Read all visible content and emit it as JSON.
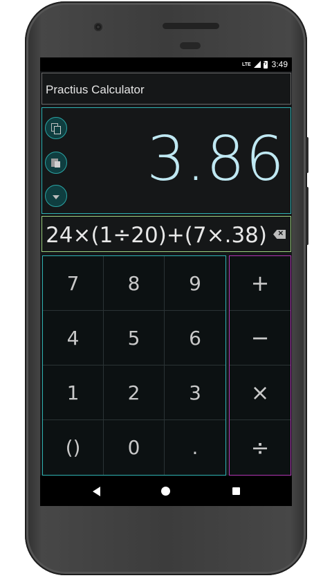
{
  "status_bar": {
    "network": "LTE",
    "time": "3:49"
  },
  "app": {
    "title": "Practius Calculator"
  },
  "result": {
    "value": "3.86"
  },
  "expression": {
    "value": "24×(1÷20)+(7×.38)"
  },
  "numpad": {
    "keys": [
      "7",
      "8",
      "9",
      "4",
      "5",
      "6",
      "1",
      "2",
      "3",
      "()",
      "0",
      "."
    ]
  },
  "operators": {
    "keys": [
      "+",
      "−",
      "×",
      "÷"
    ]
  },
  "icons": {
    "copy": "copy-icon",
    "paste": "paste-icon",
    "dropdown": "chevron-down-icon",
    "backspace": "backspace-icon",
    "nav_back": "back-triangle-icon",
    "nav_home": "home-circle-icon",
    "nav_recent": "recents-square-icon"
  },
  "colors": {
    "result_text": "#bfe8f2",
    "numpad_border": "#2fb4b4",
    "operator_border": "#b236b5",
    "expression_border": "#9cd17f"
  }
}
